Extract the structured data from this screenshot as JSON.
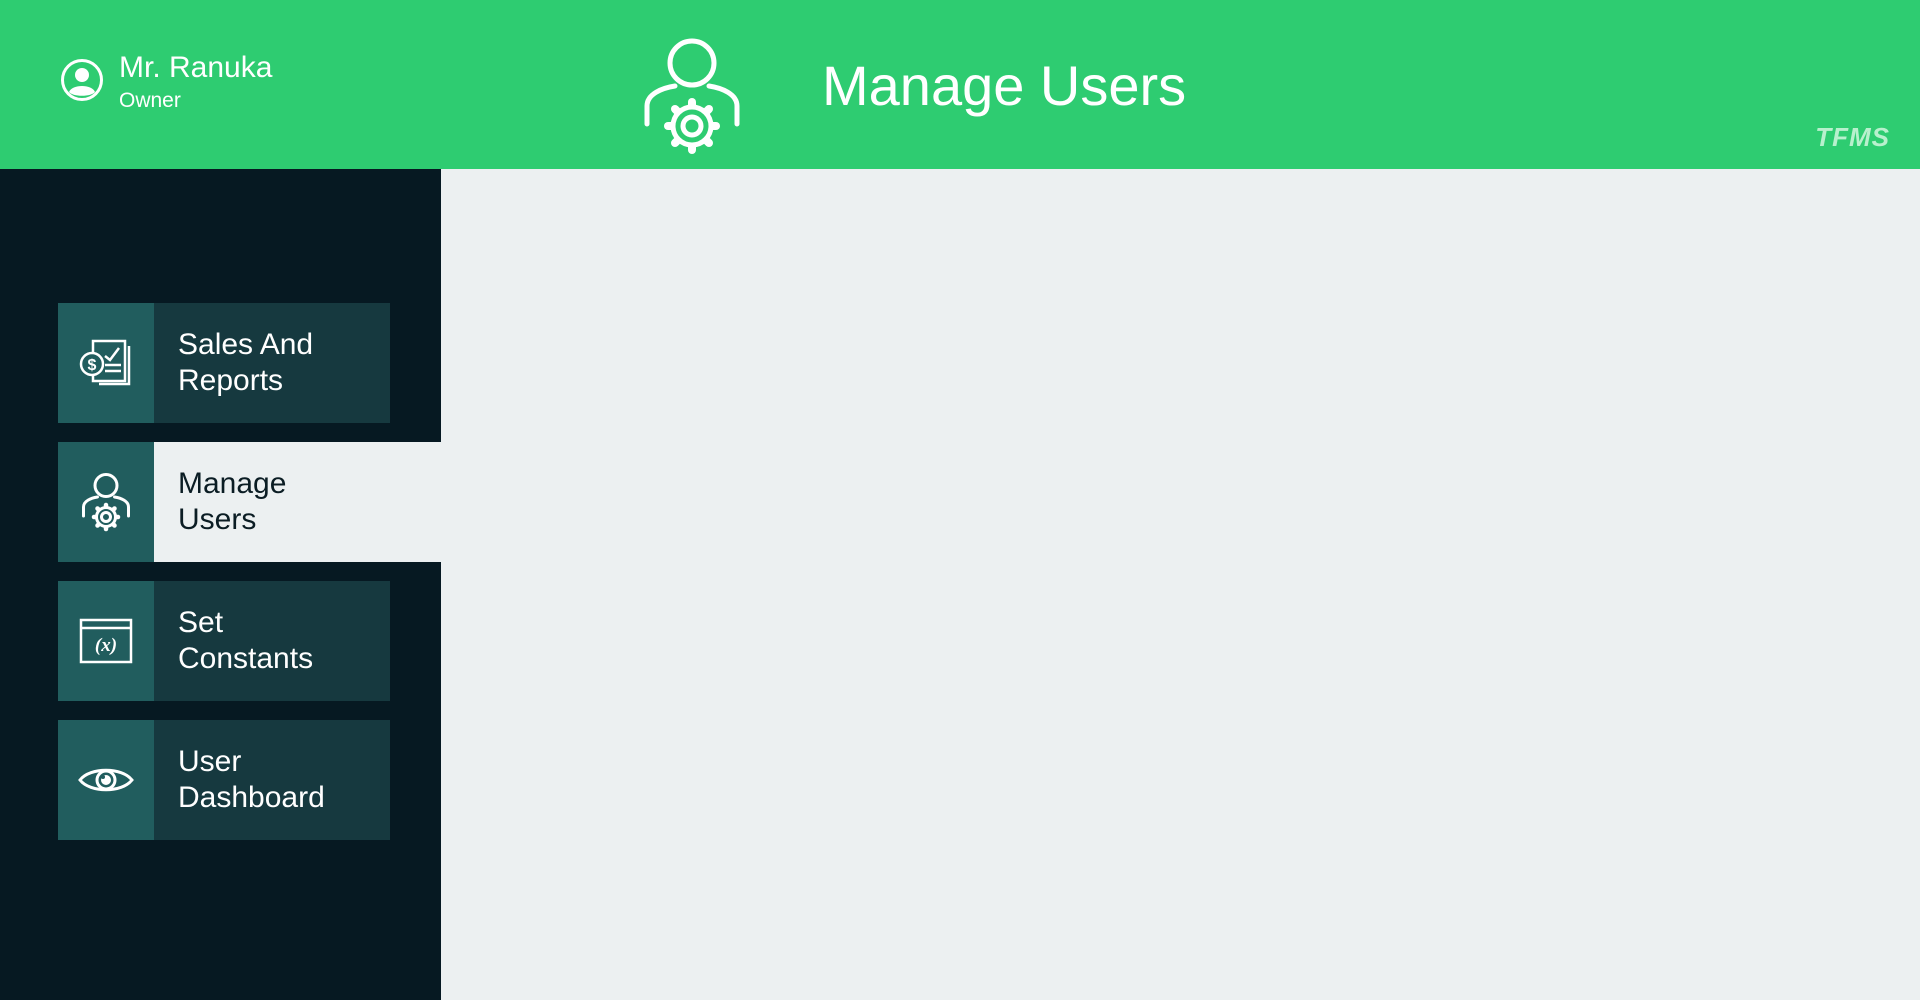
{
  "header": {
    "user_name": "Mr. Ranuka",
    "user_role": "Owner",
    "page_title": "Manage Users",
    "brand": "TFMS",
    "page_icon": "user-gear-icon",
    "avatar_icon": "user-circle-icon"
  },
  "sidebar": {
    "items": [
      {
        "label": "Sales And\nReports",
        "icon": "sales-report-icon",
        "active": false
      },
      {
        "label": "Manage\nUsers",
        "icon": "user-gear-icon",
        "active": true
      },
      {
        "label": "Set\nConstants",
        "icon": "variable-window-icon",
        "active": false
      },
      {
        "label": "User\nDashboard",
        "icon": "eye-icon",
        "active": false
      }
    ]
  },
  "colors": {
    "header_bg": "#2ecc71",
    "sidebar_bg": "#061922",
    "nav_item_bg": "#16393f",
    "nav_icon_bg": "#215d5e",
    "content_bg": "#ecf0f1"
  }
}
